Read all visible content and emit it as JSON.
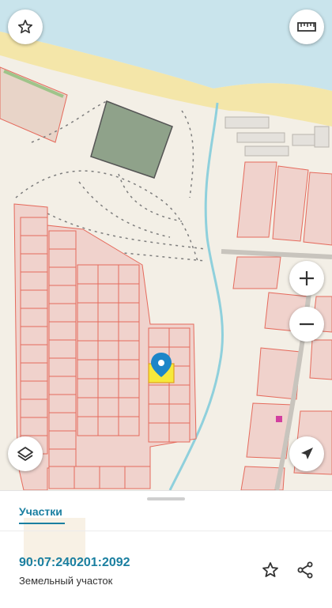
{
  "map": {
    "water_color": "#c9e4ec",
    "beach_color": "#f4e6a9",
    "land_color": "#f3efe6",
    "parcel_stroke": "#e56a5c",
    "parcel_fill": "#f0d2cc",
    "selected_parcel_fill": "#f6e93b",
    "river_color": "#8fd0dc",
    "marker_color": "#1d86c8"
  },
  "controls": {
    "favorite": "star-icon",
    "ruler": "ruler-icon",
    "zoom_in": "plus-icon",
    "zoom_out": "minus-icon",
    "layers": "layers-icon",
    "locate": "navigation-arrow-icon"
  },
  "sheet": {
    "tab_label": "Участки",
    "cadastral_number": "90:07:240201:2092",
    "parcel_type": "Земельный участок",
    "favorite_action": "star-icon",
    "share_action": "share-icon"
  }
}
